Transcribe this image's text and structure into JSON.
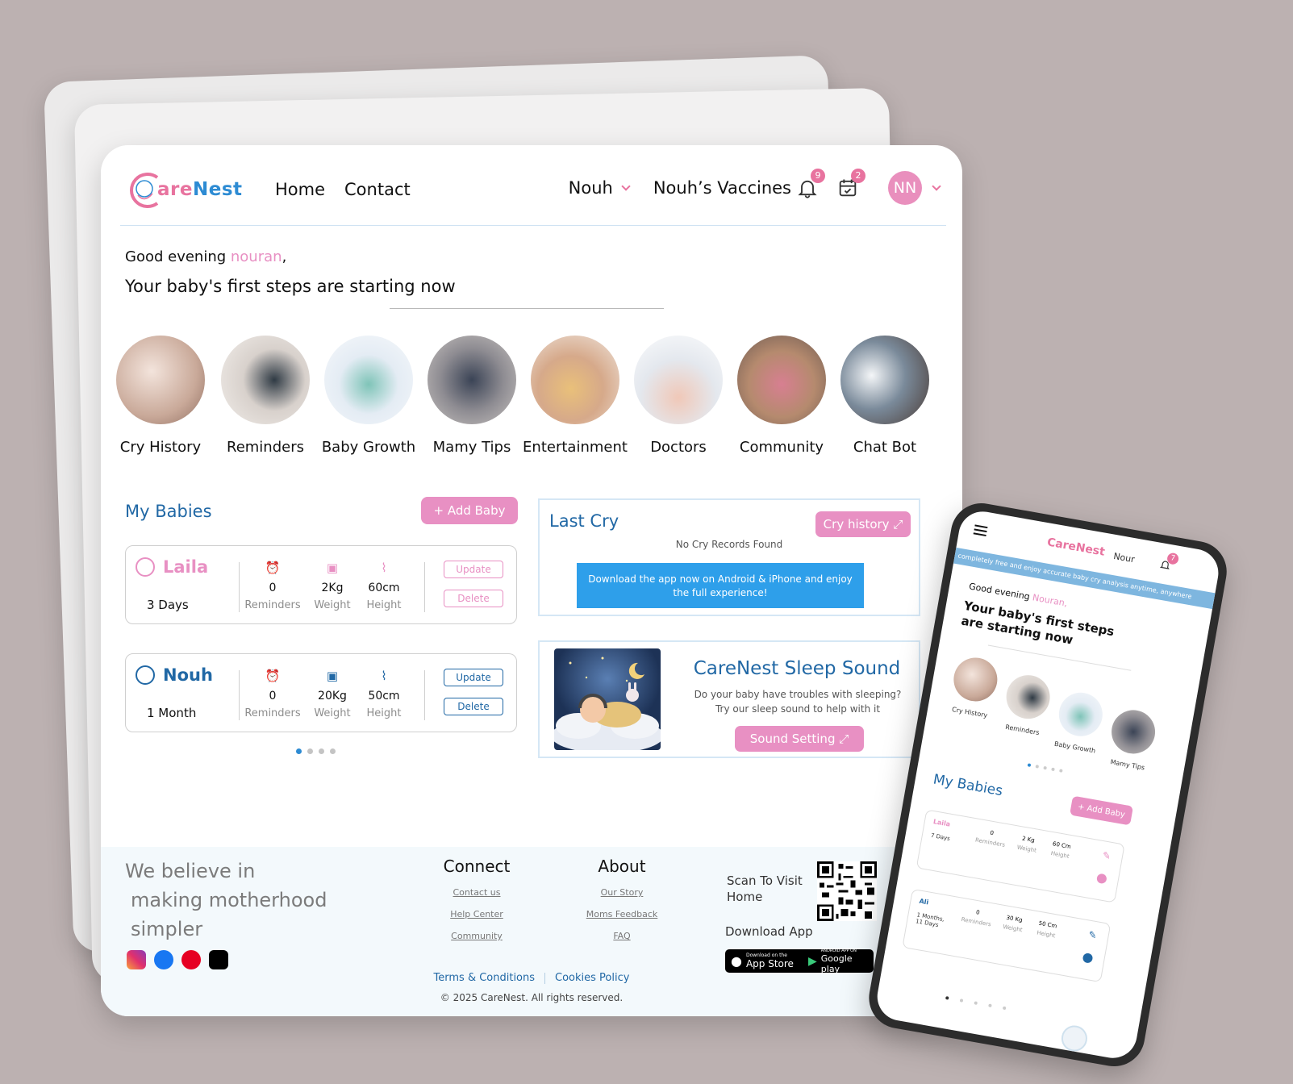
{
  "colors": {
    "pink": "#e890c3",
    "blue": "#2168a5",
    "accent_blue": "#2d8bd3"
  },
  "header": {
    "logo": {
      "part1": "are",
      "part2": "Nest"
    },
    "nav": [
      "Home",
      "Contact"
    ],
    "baby_selector": "Nouh",
    "vaccines": "Nouh’s Vaccines",
    "notif_count": "9",
    "calendar_count": "2",
    "avatar_initials": "NN"
  },
  "greeting": {
    "prefix": "Good evening ",
    "name": "nouran",
    "suffix": ",",
    "tagline": "Your baby's first steps are starting now"
  },
  "categories": [
    {
      "label": "Cry History",
      "icon": "photo-mother-baby"
    },
    {
      "label": "Reminders",
      "icon": "photo-phone-app"
    },
    {
      "label": "Baby Growth",
      "icon": "photo-baby-measure"
    },
    {
      "label": "Mamy Tips",
      "icon": "photo-father-baby"
    },
    {
      "label": "Entertainment",
      "icon": "photo-mother-globe"
    },
    {
      "label": "Doctors",
      "icon": "photo-doctor-baby"
    },
    {
      "label": "Community",
      "icon": "photo-moms-group"
    },
    {
      "label": "Chat Bot",
      "icon": "photo-robot"
    }
  ],
  "my_babies": {
    "title": "My Babies",
    "add_label": "+ Add Baby",
    "babies": [
      {
        "name": "Laila",
        "age": "3 Days",
        "reminders": "0",
        "weight": "2Kg",
        "height": "60cm",
        "color": "#e890c3"
      },
      {
        "name": "Nouh",
        "age": "1 Month",
        "reminders": "0",
        "weight": "20Kg",
        "height": "50cm",
        "color": "#2168a5"
      }
    ],
    "stat_labels": {
      "reminders": "Reminders",
      "weight": "Weight",
      "height": "Height"
    },
    "update_label": "Update",
    "delete_label": "Delete"
  },
  "last_cry": {
    "title": "Last Cry",
    "button": "Cry history ⤢",
    "empty": "No Cry Records Found",
    "download_text": "Download the app now on Android & iPhone and enjoy the full experience!"
  },
  "sleep_sound": {
    "title": "CareNest Sleep Sound",
    "line1": "Do your baby have troubles with sleeping?",
    "line2": "Try our sleep sound to help with it",
    "button": "Sound Setting ⤢"
  },
  "footer": {
    "believe": [
      "We believe in",
      "making motherhood",
      "simpler"
    ],
    "connect": {
      "title": "Connect",
      "links": [
        "Contact us",
        "Help Center",
        "Community"
      ]
    },
    "about": {
      "title": "About",
      "links": [
        "Our Story",
        "Moms Feedback",
        "FAQ"
      ]
    },
    "scan": [
      "Scan To Visit",
      "Home"
    ],
    "download_app": "Download App",
    "app_store": {
      "small": "Download on the",
      "big": "App Store"
    },
    "google_play": {
      "small": "ANDROID APP ON",
      "big": "Google play"
    },
    "terms": "Terms & Conditions",
    "cookies": "Cookies Policy",
    "copyright": "© 2025 CareNest. All rights reserved."
  },
  "phone": {
    "logo": "CareNest",
    "baby": "Nour",
    "notif_count": "7",
    "banner": "completely free and enjoy accurate baby cry analysis anytime, anywhere",
    "greeting_prefix": "Good evening ",
    "greeting_name": "Nouran,",
    "tagline": "Your baby's first steps are starting now",
    "categories": [
      "Cry History",
      "Reminders",
      "Baby Growth",
      "Mamy Tips"
    ],
    "my_babies": "My Babies",
    "add_label": "+ Add Baby",
    "babies": [
      {
        "name": "Laila",
        "age": "7 Days",
        "reminders": "0",
        "weight": "2 Kg",
        "height": "60 Cm"
      },
      {
        "name": "Ali",
        "age": "1 Months, 11 Days",
        "reminders": "0",
        "weight": "30 Kg",
        "height": "50 Cm"
      }
    ],
    "stat_labels": {
      "reminders": "Reminders",
      "weight": "Weight",
      "height": "Height"
    }
  }
}
